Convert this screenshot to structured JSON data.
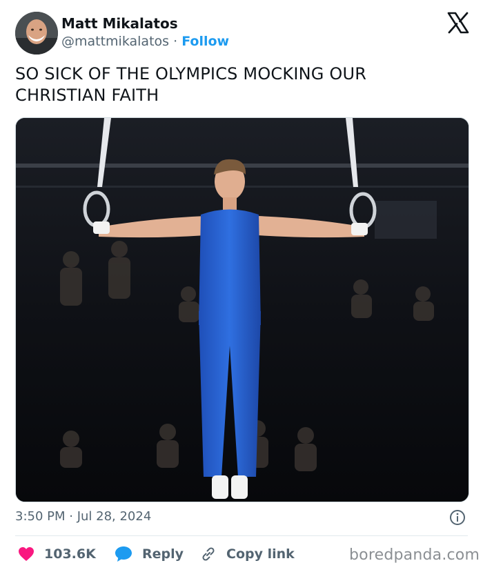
{
  "author": {
    "name": "Matt Mikalatos",
    "handle": "@mattmikalatos",
    "separator": "·",
    "follow_label": "Follow"
  },
  "tweet": {
    "text": "SO SICK OF THE OLYMPICS MOCKING OUR CHRISTIAN FAITH",
    "timestamp": "3:50 PM · Jul 28, 2024"
  },
  "actions": {
    "likes_count": "103.6K",
    "reply_label": "Reply",
    "copy_link_label": "Copy link"
  },
  "watermark": "boredpanda.com",
  "icons": {
    "logo": "x-logo-icon",
    "like": "heart-icon",
    "reply": "speech-bubble-icon",
    "copy": "link-icon",
    "info": "info-icon"
  },
  "colors": {
    "accent": "#1d9bf0",
    "like": "#f91880",
    "muted": "#536471"
  }
}
